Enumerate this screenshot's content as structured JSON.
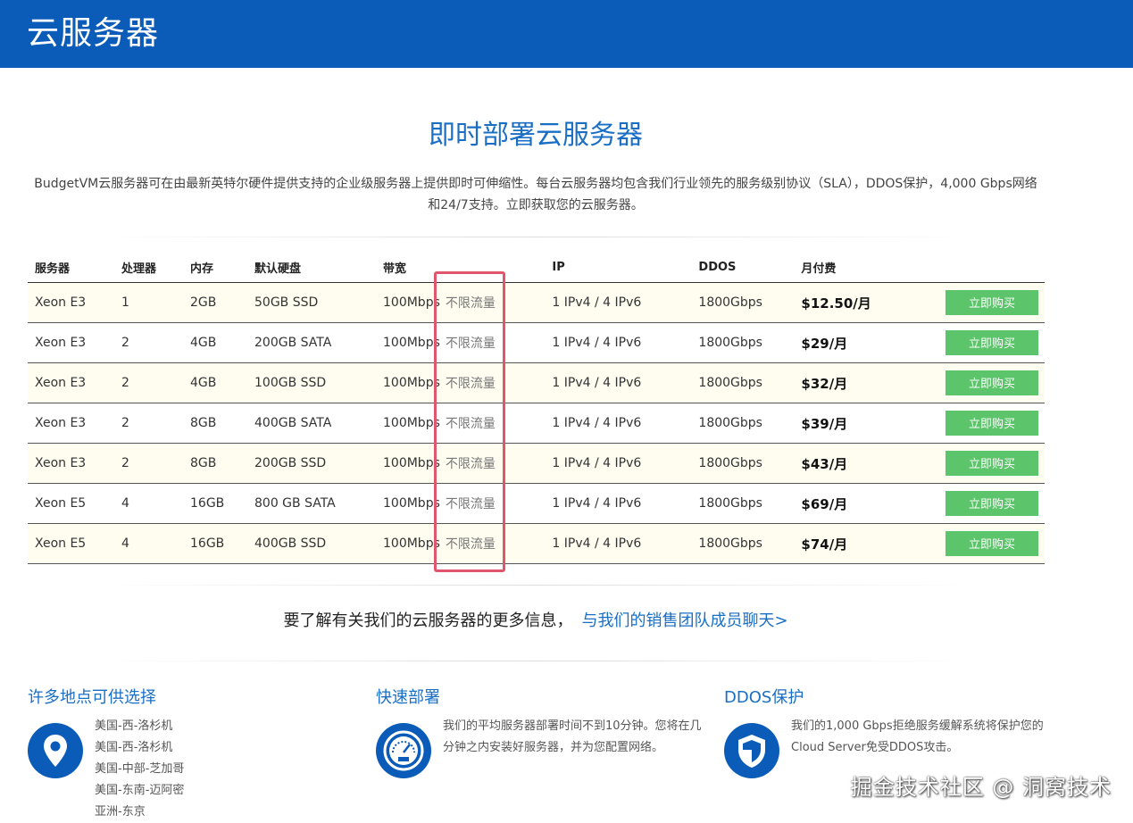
{
  "header": {
    "title": "云服务器"
  },
  "section": {
    "title": "即时部署云服务器",
    "intro_line1": "BudgetVM云服务器可在由最新英特尔硬件提供支持的企业级服务器上提供即时可伸缩性。每台云服务器均包含我们行业领先的服务级别协议（SLA），DDOS保护，4,000 Gbps网络",
    "intro_line2": "和24/7支持。立即获取您的云服务器。"
  },
  "table": {
    "headers": [
      "服务器",
      "处理器",
      "内存",
      "默认硬盘",
      "带宽",
      "IP",
      "DDOS",
      "月付费"
    ],
    "rows": [
      {
        "server": "Xeon E3",
        "cpu": "1",
        "ram": "2GB",
        "disk": "50GB SSD",
        "bandwidth": "100Mbps",
        "traffic": "不限流量",
        "ip": "1 IPv4 / 4 IPv6",
        "ddos": "1800Gbps",
        "price": "$12.50/月",
        "buy": "立即购买"
      },
      {
        "server": "Xeon E3",
        "cpu": "2",
        "ram": "4GB",
        "disk": "200GB SATA",
        "bandwidth": "100Mbps",
        "traffic": "不限流量",
        "ip": "1 IPv4 / 4 IPv6",
        "ddos": "1800Gbps",
        "price": "$29/月",
        "buy": "立即购买"
      },
      {
        "server": "Xeon E3",
        "cpu": "2",
        "ram": "4GB",
        "disk": "100GB SSD",
        "bandwidth": "100Mbps",
        "traffic": "不限流量",
        "ip": "1 IPv4 / 4 IPv6",
        "ddos": "1800Gbps",
        "price": "$32/月",
        "buy": "立即购买"
      },
      {
        "server": "Xeon E3",
        "cpu": "2",
        "ram": "8GB",
        "disk": "400GB SATA",
        "bandwidth": "100Mbps",
        "traffic": "不限流量",
        "ip": "1 IPv4 / 4 IPv6",
        "ddos": "1800Gbps",
        "price": "$39/月",
        "buy": "立即购买"
      },
      {
        "server": "Xeon E3",
        "cpu": "2",
        "ram": "8GB",
        "disk": "200GB SSD",
        "bandwidth": "100Mbps",
        "traffic": "不限流量",
        "ip": "1 IPv4 / 4 IPv6",
        "ddos": "1800Gbps",
        "price": "$43/月",
        "buy": "立即购买"
      },
      {
        "server": "Xeon E5",
        "cpu": "4",
        "ram": "16GB",
        "disk": "800 GB SATA",
        "bandwidth": "100Mbps",
        "traffic": "不限流量",
        "ip": "1 IPv4 / 4 IPv6",
        "ddos": "1800Gbps",
        "price": "$69/月",
        "buy": "立即购买"
      },
      {
        "server": "Xeon E5",
        "cpu": "4",
        "ram": "16GB",
        "disk": "400GB SSD",
        "bandwidth": "100Mbps",
        "traffic": "不限流量",
        "ip": "1 IPv4 / 4 IPv6",
        "ddos": "1800Gbps",
        "price": "$74/月",
        "buy": "立即购买"
      }
    ]
  },
  "more_info": {
    "text": "要了解有关我们的云服务器的更多信息，",
    "link": "与我们的销售团队成员聊天>"
  },
  "features": {
    "locations": {
      "title": "许多地点可供选择",
      "icon": "location-pin-icon",
      "items": [
        "美国-西-洛杉机",
        "美国-西-洛杉机",
        "美国-中部-芝加哥",
        "美国-东南-迈阿密",
        "亚洲-东京"
      ]
    },
    "deploy": {
      "title": "快速部署",
      "icon": "speedometer-icon",
      "text": "我们的平均服务器部署时间不到10分钟。您将在几分钟之内安装好服务器，并为您配置网络。"
    },
    "ddos": {
      "title": "DDOS保护",
      "icon": "shield-icon",
      "text": "我们的1,000 Gbps拒绝服务缓解系统将保护您的Cloud Server免受DDOS攻击。"
    }
  },
  "watermark": "掘金技术社区 @ 洞窝技术",
  "colors": {
    "header_bg": "#0b5cb9",
    "accent": "#1a6fc4",
    "buy_button": "#5cc46a",
    "highlight_box": "#e0566d"
  }
}
